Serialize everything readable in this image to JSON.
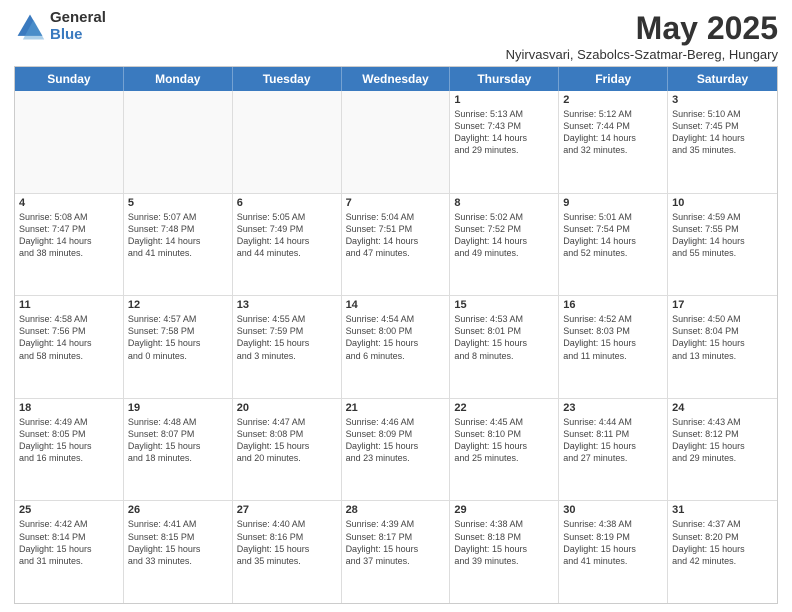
{
  "logo": {
    "general": "General",
    "blue": "Blue"
  },
  "header": {
    "title": "May 2025",
    "location": "Nyirvasvari, Szabolcs-Szatmar-Bereg, Hungary"
  },
  "days_of_week": [
    "Sunday",
    "Monday",
    "Tuesday",
    "Wednesday",
    "Thursday",
    "Friday",
    "Saturday"
  ],
  "weeks": [
    [
      {
        "day": "",
        "info": ""
      },
      {
        "day": "",
        "info": ""
      },
      {
        "day": "",
        "info": ""
      },
      {
        "day": "",
        "info": ""
      },
      {
        "day": "1",
        "info": "Sunrise: 5:13 AM\nSunset: 7:43 PM\nDaylight: 14 hours\nand 29 minutes."
      },
      {
        "day": "2",
        "info": "Sunrise: 5:12 AM\nSunset: 7:44 PM\nDaylight: 14 hours\nand 32 minutes."
      },
      {
        "day": "3",
        "info": "Sunrise: 5:10 AM\nSunset: 7:45 PM\nDaylight: 14 hours\nand 35 minutes."
      }
    ],
    [
      {
        "day": "4",
        "info": "Sunrise: 5:08 AM\nSunset: 7:47 PM\nDaylight: 14 hours\nand 38 minutes."
      },
      {
        "day": "5",
        "info": "Sunrise: 5:07 AM\nSunset: 7:48 PM\nDaylight: 14 hours\nand 41 minutes."
      },
      {
        "day": "6",
        "info": "Sunrise: 5:05 AM\nSunset: 7:49 PM\nDaylight: 14 hours\nand 44 minutes."
      },
      {
        "day": "7",
        "info": "Sunrise: 5:04 AM\nSunset: 7:51 PM\nDaylight: 14 hours\nand 47 minutes."
      },
      {
        "day": "8",
        "info": "Sunrise: 5:02 AM\nSunset: 7:52 PM\nDaylight: 14 hours\nand 49 minutes."
      },
      {
        "day": "9",
        "info": "Sunrise: 5:01 AM\nSunset: 7:54 PM\nDaylight: 14 hours\nand 52 minutes."
      },
      {
        "day": "10",
        "info": "Sunrise: 4:59 AM\nSunset: 7:55 PM\nDaylight: 14 hours\nand 55 minutes."
      }
    ],
    [
      {
        "day": "11",
        "info": "Sunrise: 4:58 AM\nSunset: 7:56 PM\nDaylight: 14 hours\nand 58 minutes."
      },
      {
        "day": "12",
        "info": "Sunrise: 4:57 AM\nSunset: 7:58 PM\nDaylight: 15 hours\nand 0 minutes."
      },
      {
        "day": "13",
        "info": "Sunrise: 4:55 AM\nSunset: 7:59 PM\nDaylight: 15 hours\nand 3 minutes."
      },
      {
        "day": "14",
        "info": "Sunrise: 4:54 AM\nSunset: 8:00 PM\nDaylight: 15 hours\nand 6 minutes."
      },
      {
        "day": "15",
        "info": "Sunrise: 4:53 AM\nSunset: 8:01 PM\nDaylight: 15 hours\nand 8 minutes."
      },
      {
        "day": "16",
        "info": "Sunrise: 4:52 AM\nSunset: 8:03 PM\nDaylight: 15 hours\nand 11 minutes."
      },
      {
        "day": "17",
        "info": "Sunrise: 4:50 AM\nSunset: 8:04 PM\nDaylight: 15 hours\nand 13 minutes."
      }
    ],
    [
      {
        "day": "18",
        "info": "Sunrise: 4:49 AM\nSunset: 8:05 PM\nDaylight: 15 hours\nand 16 minutes."
      },
      {
        "day": "19",
        "info": "Sunrise: 4:48 AM\nSunset: 8:07 PM\nDaylight: 15 hours\nand 18 minutes."
      },
      {
        "day": "20",
        "info": "Sunrise: 4:47 AM\nSunset: 8:08 PM\nDaylight: 15 hours\nand 20 minutes."
      },
      {
        "day": "21",
        "info": "Sunrise: 4:46 AM\nSunset: 8:09 PM\nDaylight: 15 hours\nand 23 minutes."
      },
      {
        "day": "22",
        "info": "Sunrise: 4:45 AM\nSunset: 8:10 PM\nDaylight: 15 hours\nand 25 minutes."
      },
      {
        "day": "23",
        "info": "Sunrise: 4:44 AM\nSunset: 8:11 PM\nDaylight: 15 hours\nand 27 minutes."
      },
      {
        "day": "24",
        "info": "Sunrise: 4:43 AM\nSunset: 8:12 PM\nDaylight: 15 hours\nand 29 minutes."
      }
    ],
    [
      {
        "day": "25",
        "info": "Sunrise: 4:42 AM\nSunset: 8:14 PM\nDaylight: 15 hours\nand 31 minutes."
      },
      {
        "day": "26",
        "info": "Sunrise: 4:41 AM\nSunset: 8:15 PM\nDaylight: 15 hours\nand 33 minutes."
      },
      {
        "day": "27",
        "info": "Sunrise: 4:40 AM\nSunset: 8:16 PM\nDaylight: 15 hours\nand 35 minutes."
      },
      {
        "day": "28",
        "info": "Sunrise: 4:39 AM\nSunset: 8:17 PM\nDaylight: 15 hours\nand 37 minutes."
      },
      {
        "day": "29",
        "info": "Sunrise: 4:38 AM\nSunset: 8:18 PM\nDaylight: 15 hours\nand 39 minutes."
      },
      {
        "day": "30",
        "info": "Sunrise: 4:38 AM\nSunset: 8:19 PM\nDaylight: 15 hours\nand 41 minutes."
      },
      {
        "day": "31",
        "info": "Sunrise: 4:37 AM\nSunset: 8:20 PM\nDaylight: 15 hours\nand 42 minutes."
      }
    ]
  ]
}
